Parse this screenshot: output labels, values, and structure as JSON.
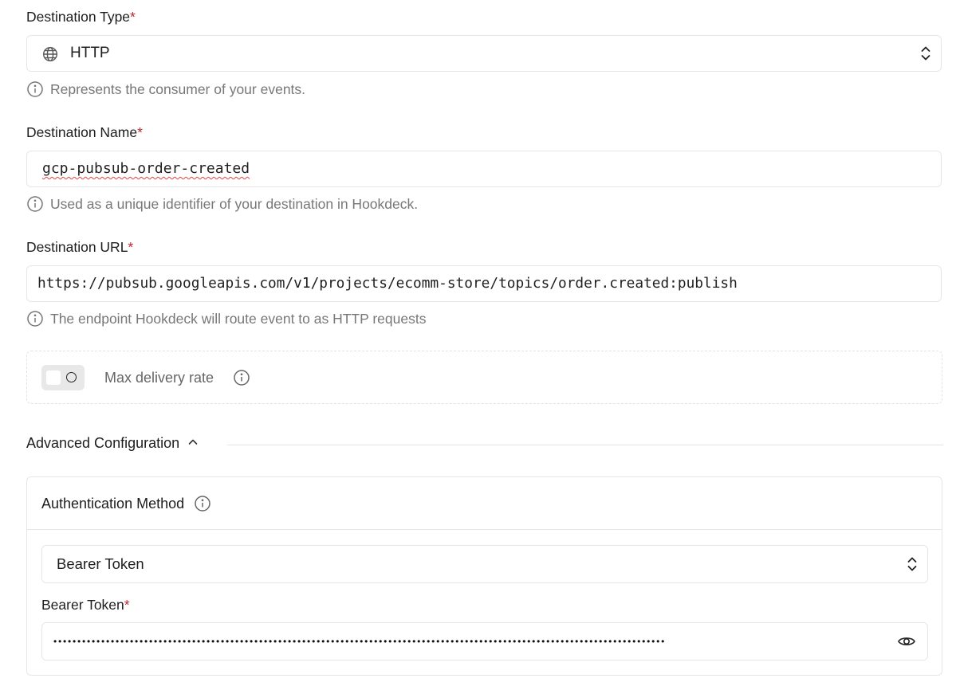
{
  "destination_type": {
    "label": "Destination Type",
    "required_mark": "*",
    "value": "HTTP",
    "help": "Represents the consumer of your events."
  },
  "destination_name": {
    "label": "Destination Name",
    "required_mark": "*",
    "value": "gcp-pubsub-order-created",
    "help": "Used as a unique identifier of your destination in Hookdeck."
  },
  "destination_url": {
    "label": "Destination URL",
    "required_mark": "*",
    "value": "https://pubsub.googleapis.com/v1/projects/ecomm-store/topics/order.created:publish",
    "help": "The endpoint Hookdeck will route event to as HTTP requests"
  },
  "max_delivery_rate": {
    "label": "Max delivery rate",
    "enabled": false
  },
  "advanced": {
    "title": "Advanced Configuration",
    "expanded": true
  },
  "authentication": {
    "title": "Authentication Method",
    "method": "Bearer Token",
    "token_label": "Bearer Token",
    "required_mark": "*",
    "token_mask": "••••••••••••••••••••••••••••••••••••••••••••••••••••••••••••••••••••••••••••••••••••••••••••••••••••••••••••••••••••••••••••••••"
  },
  "icons": {
    "globe": "globe-icon",
    "info": "info-icon",
    "chevron_updown": "chevron-updown-icon",
    "chevron_up": "chevron-up-icon",
    "eye": "eye-icon"
  },
  "colors": {
    "required": "#c3262d",
    "help_text": "#777777",
    "border": "#e6e6e6"
  }
}
